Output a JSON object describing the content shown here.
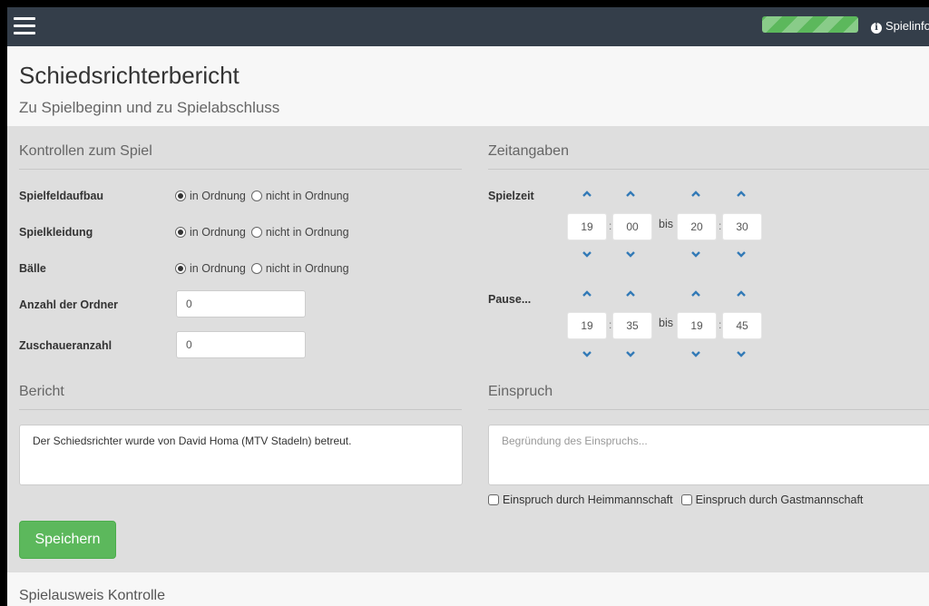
{
  "navbar": {
    "menu_icon": "hamburger-menu-icon",
    "progress_percent": 100,
    "progress_color": "#5cb85c",
    "info_icon": "info-circle-icon",
    "info_label": "Spielinfo"
  },
  "header": {
    "title": "Schiedsrichterbericht",
    "subtitle": "Zu Spielbeginn und zu Spielabschluss"
  },
  "controls": {
    "title": "Kontrollen zum Spiel",
    "rows": [
      {
        "label": "Spielfeldaufbau",
        "options": [
          "in Ordnung",
          "nicht in Ordnung"
        ],
        "selected": "in Ordnung"
      },
      {
        "label": "Spielkleidung",
        "options": [
          "in Ordnung",
          "nicht in Ordnung"
        ],
        "selected": "in Ordnung"
      },
      {
        "label": "Bälle",
        "options": [
          "in Ordnung",
          "nicht in Ordnung"
        ],
        "selected": "in Ordnung"
      }
    ],
    "ordner": {
      "label": "Anzahl der Ordner",
      "value": "0"
    },
    "zuschauer": {
      "label": "Zuschaueranzahl",
      "value": "0"
    }
  },
  "zeit": {
    "title": "Zeitangaben",
    "separator": "bis",
    "spielzeit": {
      "label": "Spielzeit",
      "start_h": "19",
      "start_m": "00",
      "end_h": "20",
      "end_m": "30"
    },
    "pause": {
      "label": "Pause...",
      "start_h": "19",
      "start_m": "35",
      "end_h": "19",
      "end_m": "45"
    }
  },
  "bericht": {
    "title": "Bericht",
    "text": "Der Schiedsrichter wurde von David Homa (MTV Stadeln) betreut."
  },
  "einspruch": {
    "title": "Einspruch",
    "placeholder": "Begründung des Einspruchs...",
    "heim_label": "Einspruch durch Heimmannschaft",
    "gast_label": "Einspruch durch Gastmannschaft"
  },
  "save_label": "Speichern",
  "bottom_section_title": "Spielausweis Kontrolle",
  "colors": {
    "navbar": "#343e4a",
    "panel": "#dedede",
    "accent_blue": "#337ab7",
    "success_green": "#5cb85c"
  }
}
